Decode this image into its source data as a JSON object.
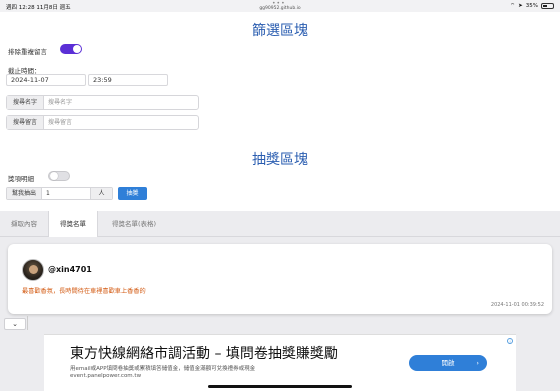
{
  "status_bar": {
    "time_date": "週四 12:28  11月8日 週五",
    "dots": "•••",
    "url": "gg90952.github.io",
    "battery": "35%"
  },
  "filter": {
    "title": "篩選區塊",
    "exclude_duplicates_label": "排除重複留言",
    "exclude_duplicates_on": true,
    "deadline_label": "截止時間：",
    "deadline_date": "2024-11-07",
    "deadline_time": "23:59",
    "search_name_label": "搜尋名字",
    "search_name_placeholder": "搜尋名字",
    "search_comment_label": "搜尋留言",
    "search_comment_placeholder": "搜尋留言"
  },
  "draw": {
    "title": "抽獎區塊",
    "prize_detail_label": "獎項明細",
    "prize_detail_on": false,
    "draw_count_label": "幫我抽出",
    "draw_count_value": "1",
    "draw_count_unit": "人",
    "draw_button": "抽獎"
  },
  "tabs": [
    {
      "label": "擷取內容",
      "active": false
    },
    {
      "label": "得獎名單",
      "active": true
    },
    {
      "label": "得獎名單(表格)",
      "active": false
    }
  ],
  "winner": {
    "name": "@xin4701",
    "comment": "最喜歡香氛，長時間待在車裡喜歡車上香香的",
    "time": "2024-11-01 00:39:52"
  },
  "ad": {
    "title": "東方快線網絡市調活動 – 填問卷抽獎賺獎勵",
    "description": "用email或APP填問卷抽獎或累積填答儲值金，儲值金滿額可兌換禮券或現金",
    "url": "event.panelpower.com.tw",
    "button": "開啟",
    "info_icon": "info-icon"
  },
  "colors": {
    "accent": "#2f7fd8",
    "title_blue": "#2a5db0",
    "toggle_on": "#5b2fd6",
    "comment_orange": "#d35a12"
  }
}
